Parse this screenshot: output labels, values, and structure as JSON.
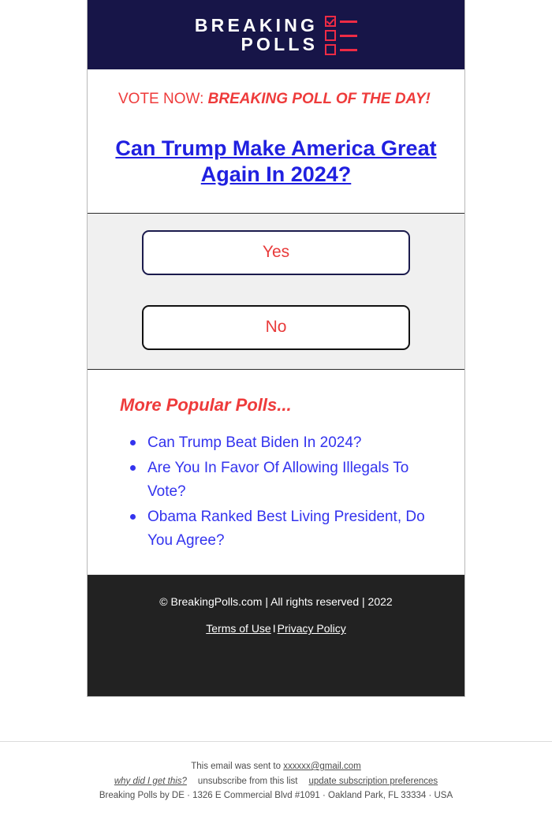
{
  "brand": {
    "logo_line1": "BREAKING",
    "logo_line2": "POLLS",
    "navy": "#171548",
    "red": "#ee3b3b",
    "logo_red": "#ef2b45",
    "link_blue": "#2020e0",
    "list_blue": "#3333ee",
    "footer_dark": "#222222",
    "vote_bg": "#f0f0f0"
  },
  "poll": {
    "kicker_lead": "VOTE NOW: ",
    "kicker_em": "BREAKING POLL OF THE DAY!",
    "question": "Can Trump Make America Great Again In 2024?",
    "options": [
      {
        "label": "Yes"
      },
      {
        "label": "No"
      }
    ]
  },
  "more_polls": {
    "title": "More Popular Polls...",
    "items": [
      {
        "label": "Can Trump Beat Biden In 2024?"
      },
      {
        "label": "Are You In Favor Of Allowing Illegals To Vote?"
      },
      {
        "label": "Obama Ranked Best Living President, Do You Agree?"
      }
    ]
  },
  "card_footer": {
    "copyright": "© BreakingPolls.com | All rights reserved | 2022",
    "terms_label": "Terms of Use",
    "separator": "I",
    "privacy_label": "Privacy Policy"
  },
  "email_footer": {
    "sent_to_prefix": "This email was sent to ",
    "recipient_email": "xxxxxx@gmail.com",
    "why_link": "why did I get this?",
    "unsubscribe_link": "unsubscribe from this list",
    "preferences_link": "update subscription preferences",
    "address": "Breaking Polls by DE · 1326 E Commercial Blvd #1091 · Oakland Park, FL 33334 · USA"
  }
}
